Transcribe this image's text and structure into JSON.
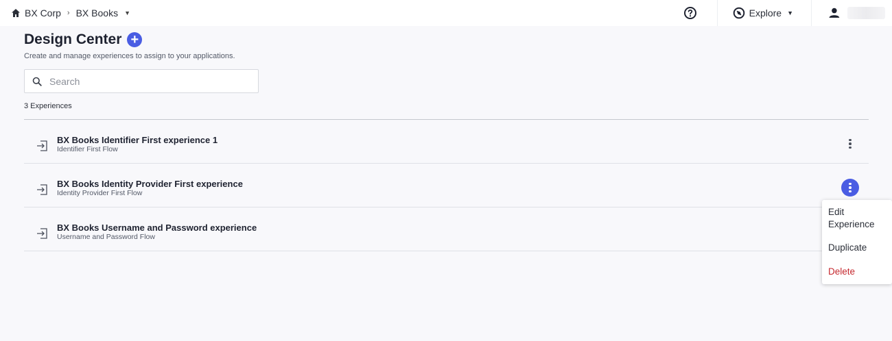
{
  "breadcrumb": {
    "org": "BX Corp",
    "env": "BX Books"
  },
  "topbar": {
    "explore_label": "Explore"
  },
  "page": {
    "title": "Design Center",
    "subtitle": "Create and manage experiences to assign to your applications.",
    "search_placeholder": "Search",
    "count_label": "3 Experiences"
  },
  "experiences": [
    {
      "title": "BX Books Identifier First experience 1",
      "subtitle": "Identifier First Flow"
    },
    {
      "title": "BX Books Identity Provider First experience",
      "subtitle": "Identity Provider First Flow"
    },
    {
      "title": "BX Books Username and Password experience",
      "subtitle": "Username and Password Flow"
    }
  ],
  "menu": {
    "edit": "Edit Experience",
    "duplicate": "Duplicate",
    "delete": "Delete"
  },
  "colors": {
    "accent": "#4a5de3",
    "danger": "#c5282e",
    "background": "#f8f8fb"
  }
}
